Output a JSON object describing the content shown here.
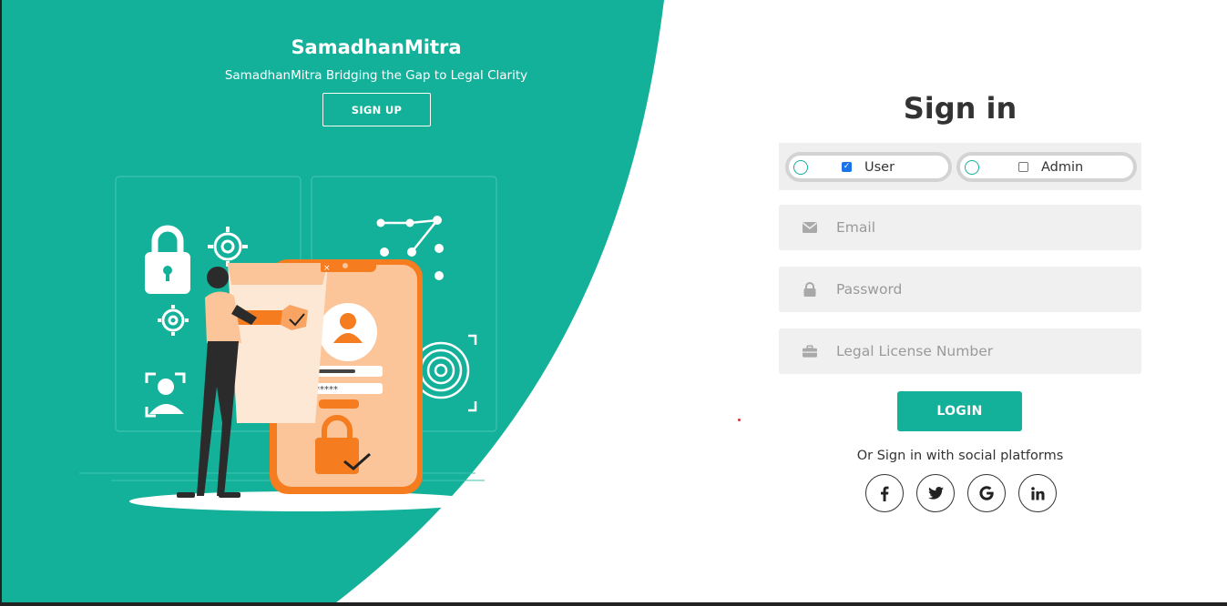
{
  "brand": {
    "title": "SamadhanMitra",
    "subtitle": "SamadhanMitra Bridging the Gap to Legal Clarity",
    "signup_label": "SIGN UP"
  },
  "signin": {
    "title": "Sign in",
    "roles": [
      {
        "label": "User",
        "checked": true
      },
      {
        "label": "Admin",
        "checked": false
      }
    ],
    "email_placeholder": "Email",
    "password_placeholder": "Password",
    "license_placeholder": "Legal License Number",
    "login_label": "LOGIN",
    "social_text": "Or Sign in with social platforms",
    "social_icons": [
      "facebook-icon",
      "twitter-icon",
      "google-icon",
      "linkedin-icon"
    ]
  },
  "colors": {
    "accent": "#13b09a",
    "illustration_orange": "#f57c1f"
  }
}
